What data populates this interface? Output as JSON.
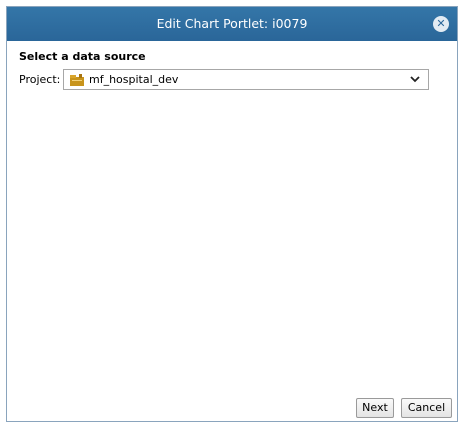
{
  "dialog": {
    "title": "Edit Chart Portlet: i0079",
    "close_icon": "close-circle-icon"
  },
  "content": {
    "heading": "Select a data source",
    "project_label": "Project:",
    "project_value": "mf_hospital_dev",
    "project_icon": "project-folder-icon",
    "dropdown_icon": "chevron-down-icon"
  },
  "buttons": {
    "next": "Next",
    "cancel": "Cancel"
  },
  "colors": {
    "titlebar": "#2a6699",
    "project_icon": "#c8941c"
  }
}
